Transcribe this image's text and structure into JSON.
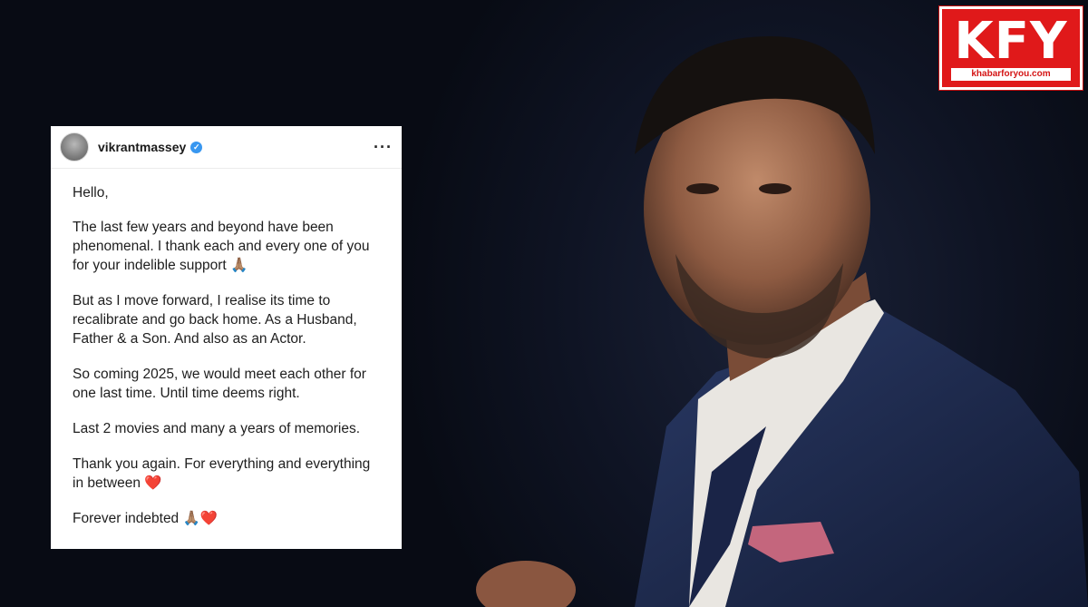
{
  "post": {
    "username": "vikrantmassey",
    "verified_icon": "verified-badge-icon",
    "more_icon": "more-options-icon",
    "paragraphs": [
      "Hello,",
      "The last few years and beyond have been phenomenal. I thank each and every one of you for your indelible support 🙏🏽",
      "But as I move forward, I realise its time to recalibrate and go back home. As a Husband, Father & a Son. And also as an Actor.",
      "So coming 2025, we would meet each other for one last time. Until time deems right.",
      "Last 2 movies and many a years of memories.",
      "Thank you again. For everything and everything in between ❤️",
      "Forever indebted 🙏🏽❤️"
    ]
  },
  "logo": {
    "main": "KFY",
    "sub": "khabarforyou.com",
    "color": "#e0191a"
  }
}
